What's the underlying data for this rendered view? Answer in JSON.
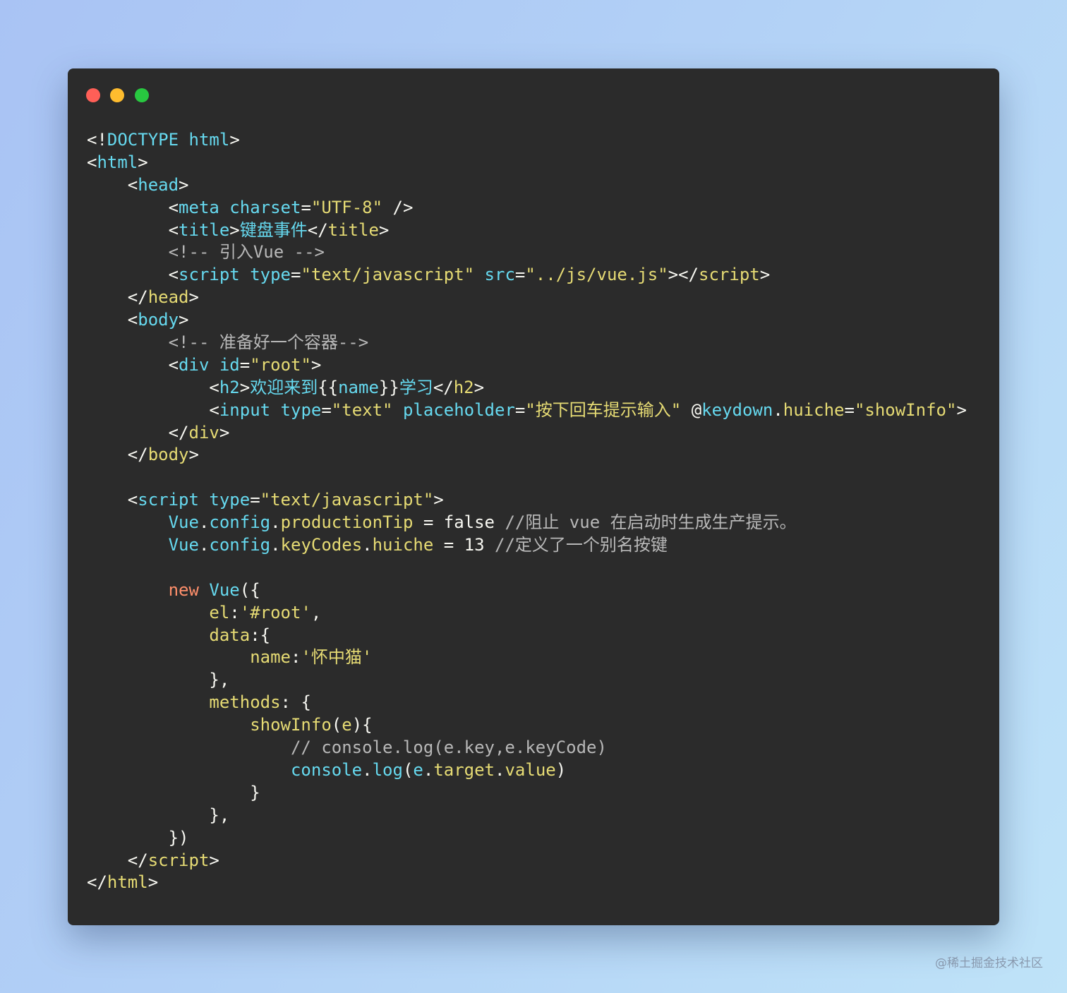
{
  "window": {
    "controls": [
      "close",
      "minimize",
      "maximize"
    ],
    "colors": {
      "close": "#ff5f57",
      "minimize": "#febc2e",
      "maximize": "#28c840",
      "background": "#2b2b2b"
    }
  },
  "code": [
    [
      [
        "pl",
        "<!"
      ],
      [
        "cy",
        "DOCTYPE"
      ],
      [
        "pl",
        " "
      ],
      [
        "cy",
        "html"
      ],
      [
        "pl",
        ">"
      ]
    ],
    [
      [
        "pl",
        "<"
      ],
      [
        "cy",
        "html"
      ],
      [
        "pl",
        ">"
      ]
    ],
    [
      [
        "pl",
        "    <"
      ],
      [
        "cy",
        "head"
      ],
      [
        "pl",
        ">"
      ]
    ],
    [
      [
        "pl",
        "        <"
      ],
      [
        "cy",
        "meta"
      ],
      [
        "pl",
        " "
      ],
      [
        "cy",
        "charset"
      ],
      [
        "pl",
        "="
      ],
      [
        "ye",
        "\"UTF-8\""
      ],
      [
        "pl",
        " />"
      ]
    ],
    [
      [
        "pl",
        "        <"
      ],
      [
        "cy",
        "title"
      ],
      [
        "pl",
        ">"
      ],
      [
        "cy",
        "键盘事件"
      ],
      [
        "pl",
        "</"
      ],
      [
        "ye",
        "title"
      ],
      [
        "pl",
        ">"
      ]
    ],
    [
      [
        "cm",
        "        <!-- 引入Vue -->"
      ]
    ],
    [
      [
        "pl",
        "        <"
      ],
      [
        "cy",
        "script"
      ],
      [
        "pl",
        " "
      ],
      [
        "cy",
        "type"
      ],
      [
        "pl",
        "="
      ],
      [
        "ye",
        "\"text/javascript\""
      ],
      [
        "pl",
        " "
      ],
      [
        "cy",
        "src"
      ],
      [
        "pl",
        "="
      ],
      [
        "ye",
        "\"../js/vue.js\""
      ],
      [
        "pl",
        "></"
      ],
      [
        "ye",
        "script"
      ],
      [
        "pl",
        ">"
      ]
    ],
    [
      [
        "pl",
        "    </"
      ],
      [
        "ye",
        "head"
      ],
      [
        "pl",
        ">"
      ]
    ],
    [
      [
        "pl",
        "    <"
      ],
      [
        "cy",
        "body"
      ],
      [
        "pl",
        ">"
      ]
    ],
    [
      [
        "cm",
        "        <!-- 准备好一个容器-->"
      ]
    ],
    [
      [
        "pl",
        "        <"
      ],
      [
        "cy",
        "div"
      ],
      [
        "pl",
        " "
      ],
      [
        "cy",
        "id"
      ],
      [
        "pl",
        "="
      ],
      [
        "ye",
        "\"root\""
      ],
      [
        "pl",
        ">"
      ]
    ],
    [
      [
        "pl",
        "            <"
      ],
      [
        "cy",
        "h2"
      ],
      [
        "pl",
        ">"
      ],
      [
        "cy",
        "欢迎来到"
      ],
      [
        "pl",
        "{{"
      ],
      [
        "cy",
        "name"
      ],
      [
        "pl",
        "}}"
      ],
      [
        "cy",
        "学习"
      ],
      [
        "pl",
        "</"
      ],
      [
        "ye",
        "h2"
      ],
      [
        "pl",
        ">"
      ]
    ],
    [
      [
        "pl",
        "            <"
      ],
      [
        "cy",
        "input"
      ],
      [
        "pl",
        " "
      ],
      [
        "cy",
        "type"
      ],
      [
        "pl",
        "="
      ],
      [
        "ye",
        "\"text\""
      ],
      [
        "pl",
        " "
      ],
      [
        "cy",
        "placeholder"
      ],
      [
        "pl",
        "="
      ],
      [
        "ye",
        "\"按下回车提示输入\""
      ],
      [
        "pl",
        " @"
      ],
      [
        "cy",
        "keydown"
      ],
      [
        "pl",
        "."
      ],
      [
        "ye",
        "huiche"
      ],
      [
        "pl",
        "="
      ],
      [
        "ye",
        "\"showInfo\""
      ],
      [
        "pl",
        ">"
      ]
    ],
    [
      [
        "pl",
        "        </"
      ],
      [
        "ye",
        "div"
      ],
      [
        "pl",
        ">"
      ]
    ],
    [
      [
        "pl",
        "    </"
      ],
      [
        "ye",
        "body"
      ],
      [
        "pl",
        ">"
      ]
    ],
    [],
    [
      [
        "pl",
        "    <"
      ],
      [
        "cy",
        "script"
      ],
      [
        "pl",
        " "
      ],
      [
        "cy",
        "type"
      ],
      [
        "pl",
        "="
      ],
      [
        "ye",
        "\"text/javascript\""
      ],
      [
        "pl",
        ">"
      ]
    ],
    [
      [
        "cy",
        "        Vue"
      ],
      [
        "pl",
        "."
      ],
      [
        "cy",
        "config"
      ],
      [
        "pl",
        "."
      ],
      [
        "ye",
        "productionTip"
      ],
      [
        "pl",
        " = false "
      ],
      [
        "cm",
        "//阻止 vue 在启动时生成生产提示。"
      ]
    ],
    [
      [
        "cy",
        "        Vue"
      ],
      [
        "pl",
        "."
      ],
      [
        "cy",
        "config"
      ],
      [
        "pl",
        "."
      ],
      [
        "ye",
        "keyCodes"
      ],
      [
        "pl",
        "."
      ],
      [
        "ye",
        "huiche"
      ],
      [
        "pl",
        " = 13 "
      ],
      [
        "cm",
        "//定义了一个别名按键"
      ]
    ],
    [],
    [
      [
        "kw",
        "        new"
      ],
      [
        "pl",
        " "
      ],
      [
        "cy",
        "Vue"
      ],
      [
        "pl",
        "({"
      ]
    ],
    [
      [
        "ye",
        "            el"
      ],
      [
        "pl",
        ":"
      ],
      [
        "ye",
        "'#root'"
      ],
      [
        "pl",
        ","
      ]
    ],
    [
      [
        "ye",
        "            data"
      ],
      [
        "pl",
        ":{"
      ]
    ],
    [
      [
        "ye",
        "                name"
      ],
      [
        "pl",
        ":"
      ],
      [
        "ye",
        "'怀中猫'"
      ]
    ],
    [
      [
        "pl",
        "            },"
      ]
    ],
    [
      [
        "ye",
        "            methods"
      ],
      [
        "pl",
        ": {"
      ]
    ],
    [
      [
        "ye",
        "                showInfo"
      ],
      [
        "pl",
        "("
      ],
      [
        "ye",
        "e"
      ],
      [
        "pl",
        "){"
      ]
    ],
    [
      [
        "cm",
        "                    // console.log(e.key,e.keyCode)"
      ]
    ],
    [
      [
        "cy",
        "                    console"
      ],
      [
        "pl",
        "."
      ],
      [
        "cy",
        "log"
      ],
      [
        "pl",
        "("
      ],
      [
        "cy",
        "e"
      ],
      [
        "pl",
        "."
      ],
      [
        "ye",
        "target"
      ],
      [
        "pl",
        "."
      ],
      [
        "ye",
        "value"
      ],
      [
        "pl",
        ")"
      ]
    ],
    [
      [
        "pl",
        "                }"
      ]
    ],
    [
      [
        "pl",
        "            },"
      ]
    ],
    [
      [
        "pl",
        "        })"
      ]
    ],
    [
      [
        "pl",
        "    </"
      ],
      [
        "ye",
        "script"
      ],
      [
        "pl",
        ">"
      ]
    ],
    [
      [
        "pl",
        "</"
      ],
      [
        "ye",
        "html"
      ],
      [
        "pl",
        ">"
      ]
    ]
  ],
  "watermark": "@稀土掘金技术社区"
}
